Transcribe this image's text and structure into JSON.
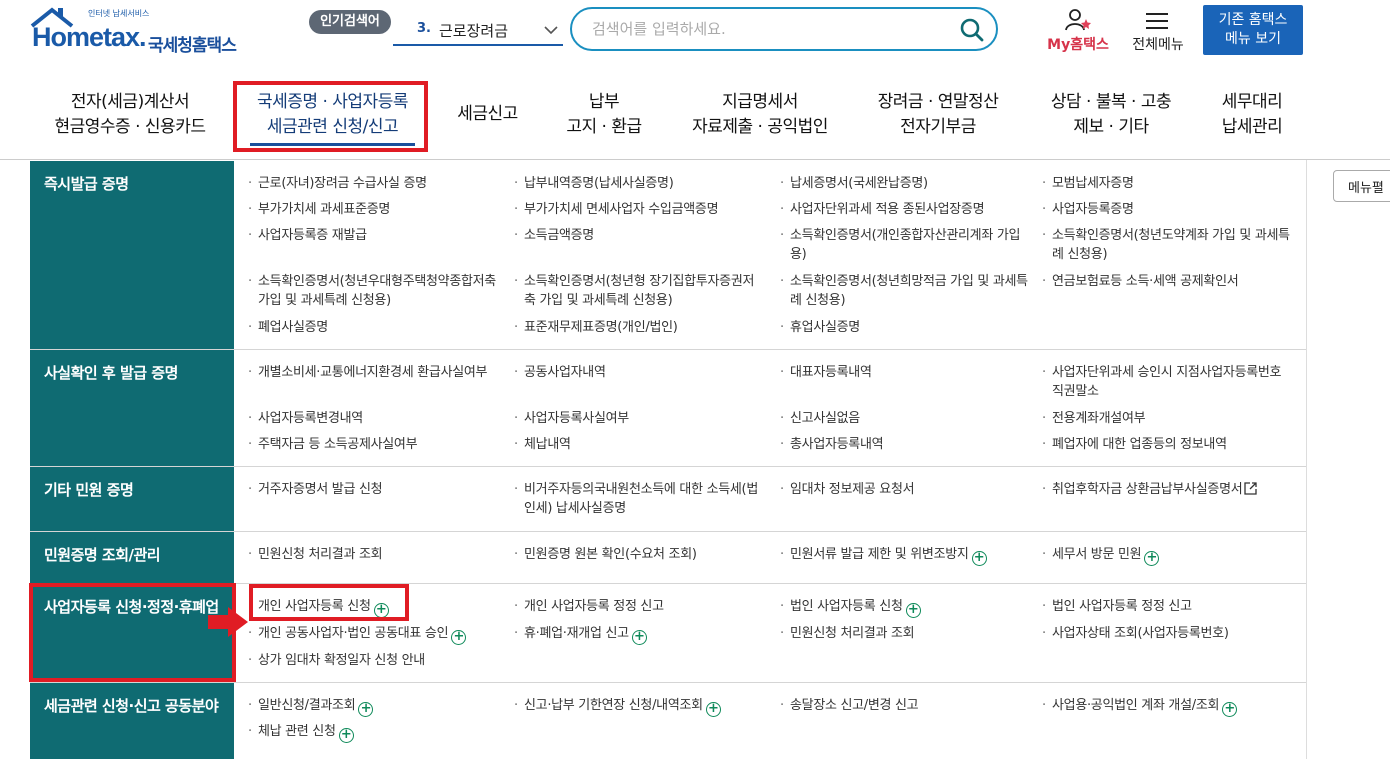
{
  "header": {
    "logo_text": "Hometax.",
    "logo_sub": "인터넷 납세서비스",
    "logo_name": "국세청홈택스",
    "popular_label": "인기검색어",
    "popular_rank": "3.",
    "popular_term": "근로장려금",
    "search_placeholder": "검색어를 입력하세요.",
    "my_hometax": "My홈택스",
    "all_menu": "전체메뉴",
    "legacy_line1": "기존 홈택스",
    "legacy_line2": "메뉴 보기"
  },
  "gnb": [
    {
      "line1": "전자(세금)계산서",
      "line2": "현금영수증 · 신용카드"
    },
    {
      "line1": "국세증명 · 사업자등록",
      "line2": "세금관련 신청/신고"
    },
    {
      "line1": "세금신고",
      "line2": ""
    },
    {
      "line1": "납부",
      "line2": "고지 · 환급"
    },
    {
      "line1": "지급명세서",
      "line2": "자료제출 · 공익법인"
    },
    {
      "line1": "장려금 · 연말정산",
      "line2": "전자기부금"
    },
    {
      "line1": "상담 · 불복 · 고충",
      "line2": "제보 · 기타"
    },
    {
      "line1": "세무대리",
      "line2": "납세관리"
    }
  ],
  "menu_filter": "메뉴펼",
  "sections": [
    {
      "title": "즉시발급 증명",
      "items": [
        "근로(자녀)장려금 수급사실 증명",
        "납부내역증명(납세사실증명)",
        "납세증명서(국세완납증명)",
        "모범납세자증명",
        "부가가치세 과세표준증명",
        "부가가치세 면세사업자 수입금액증명",
        "사업자단위과세 적용 종된사업장증명",
        "사업자등록증명",
        "사업자등록증 재발급",
        "소득금액증명",
        "소득확인증명서(개인종합자산관리계좌 가입용)",
        "소득확인증명서(청년도약계좌 가입 및 과세특례 신청용)",
        "소득확인증명서(청년우대형주택청약종합저축 가입 및 과세특례 신청용)",
        "소득확인증명서(청년형 장기집합투자증권저축 가입 및 과세특례 신청용)",
        "소득확인증명서(청년희망적금 가입 및 과세특례 신청용)",
        "연금보험료등 소득·세액 공제확인서",
        "폐업사실증명",
        "표준재무제표증명(개인/법인)",
        "휴업사실증명"
      ]
    },
    {
      "title": "사실확인 후 발급 증명",
      "items": [
        "개별소비세·교통에너지환경세 환급사실여부",
        "공동사업자내역",
        "대표자등록내역",
        "사업자단위과세 승인시 지점사업자등록번호 직권말소",
        "사업자등록변경내역",
        "사업자등록사실여부",
        "신고사실없음",
        "전용계좌개설여부",
        "주택자금 등 소득공제사실여부",
        "체납내역",
        "총사업자등록내역",
        "폐업자에 대한 업종등의 정보내역"
      ]
    },
    {
      "title": "기타 민원 증명",
      "items": [
        "거주자증명서 발급 신청",
        "비거주자등의국내원천소득에 대한 소득세(법인세) 납세사실증명",
        "임대차 정보제공 요청서",
        "취업후학자금 상환금납부사실증명서"
      ]
    },
    {
      "title": "민원증명 조회/관리",
      "items": [
        "민원신청 처리결과 조회",
        "민원증명 원본 확인(수요처 조회)",
        "민원서류 발급 제한 및 위변조방지",
        "세무서 방문 민원"
      ]
    },
    {
      "title": "사업자등록 신청·정정·휴폐업",
      "items": [
        "개인 사업자등록 신청",
        "개인 사업자등록 정정 신고",
        "법인 사업자등록 신청",
        "법인 사업자등록 정정 신고",
        "개인 공동사업자·법인 공동대표 승인",
        "휴·폐업·재개업 신고",
        "민원신청 처리결과 조회",
        "사업자상태 조회(사업자등록번호)",
        "상가 임대차 확정일자 신청 안내"
      ]
    },
    {
      "title": "세금관련 신청·신고 공동분야",
      "items": [
        "일반신청/결과조회",
        "신고·납부 기한연장 신청/내역조회",
        "송달장소 신고/변경 신고",
        "사업용·공익법인 계좌 개설/조회",
        "체납 관련 신청"
      ]
    }
  ],
  "colors": {
    "section_head": "#0f6b72",
    "brand_blue": "#1a5aa8",
    "highlight_red": "#e01c24",
    "plus_green": "#0f8a5a"
  }
}
